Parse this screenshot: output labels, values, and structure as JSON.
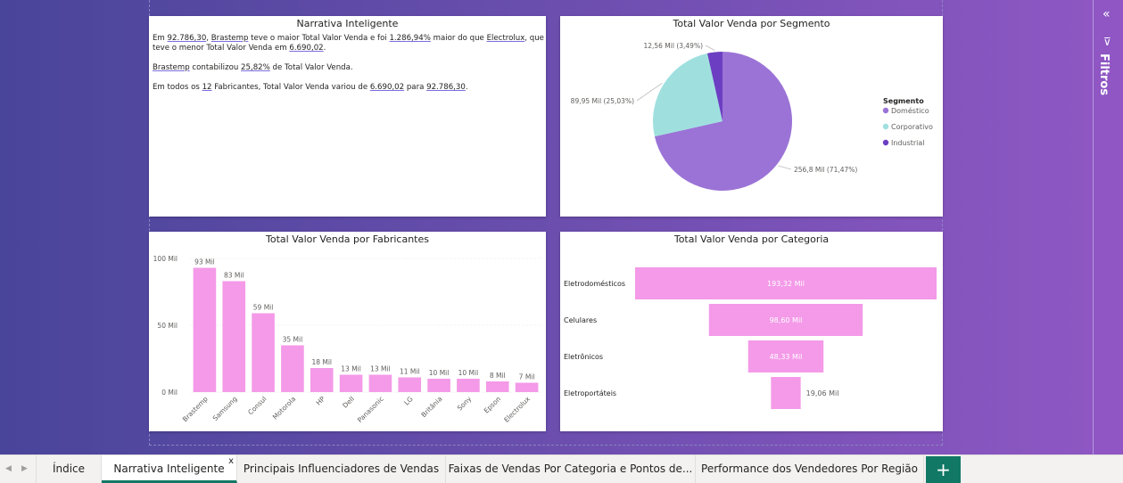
{
  "narrative": {
    "title": "Narrativa Inteligente",
    "paragraphs": [
      [
        {
          "t": "Em "
        },
        {
          "t": "92.786,30",
          "u": true
        },
        {
          "t": ", "
        },
        {
          "t": "Brastemp",
          "u": true
        },
        {
          "t": " teve o maior Total Valor Venda e foi "
        },
        {
          "t": "1.286,94%",
          "u": true
        },
        {
          "t": " maior do que "
        },
        {
          "t": "Electrolux",
          "u": true
        },
        {
          "t": ", que teve o menor Total Valor Venda em "
        },
        {
          "t": "6.690,02",
          "u": true
        },
        {
          "t": "."
        }
      ],
      [
        {
          "t": "Brastemp",
          "u": true
        },
        {
          "t": " contabilizou "
        },
        {
          "t": "25,82%",
          "u": true
        },
        {
          "t": " de Total Valor Venda."
        }
      ],
      [
        {
          "t": "Em todos os "
        },
        {
          "t": "12",
          "u": true
        },
        {
          "t": " Fabricantes, Total Valor Venda variou de "
        },
        {
          "t": "6.690,02",
          "u": true
        },
        {
          "t": " para "
        },
        {
          "t": "92.786,30",
          "u": true
        },
        {
          "t": "."
        }
      ]
    ]
  },
  "chart_data": [
    {
      "type": "pie",
      "title": "Total Valor Venda por Segmento",
      "legend_title": "Segmento",
      "legend_position": "right",
      "slices": [
        {
          "name": "Doméstico",
          "value": 256.8,
          "label": "256,8 Mil (71,47%)",
          "color": "#9b73d6"
        },
        {
          "name": "Corporativo",
          "value": 89.95,
          "label": "89,95 Mil (25,03%)",
          "color": "#9fe0df"
        },
        {
          "name": "Industrial",
          "value": 12.56,
          "label": "12,56 Mil (3,49%)",
          "color": "#6c3fc2"
        }
      ]
    },
    {
      "type": "bar",
      "title": "Total Valor Venda por Fabricantes",
      "categories": [
        "Brastemp",
        "Samsung",
        "Consul",
        "Motorola",
        "HP",
        "Dell",
        "Panasonic",
        "LG",
        "Britânia",
        "Sony",
        "Epson",
        "Electrolux"
      ],
      "values": [
        93,
        83,
        59,
        35,
        18,
        13,
        13,
        11,
        10,
        10,
        8,
        7
      ],
      "value_labels": [
        "93 Mil",
        "83 Mil",
        "59 Mil",
        "35 Mil",
        "18 Mil",
        "13 Mil",
        "13 Mil",
        "11 Mil",
        "10 Mil",
        "10 Mil",
        "8 Mil",
        "7 Mil"
      ],
      "yticks": [
        "100 Mil",
        "50 Mil",
        "0 Mil"
      ],
      "ylim": [
        0,
        100
      ],
      "color": "#f49ae8",
      "grid": true
    },
    {
      "type": "bar",
      "orientation": "funnel",
      "title": "Total Valor Venda por Categoria",
      "categories": [
        "Eletrodomésticos",
        "Celulares",
        "Eletrônicos",
        "Eletroportáteis"
      ],
      "values": [
        193.32,
        98.6,
        48.33,
        19.06
      ],
      "value_labels": [
        "193,32 Mil",
        "98,60 Mil",
        "48,33 Mil",
        "19,06 Mil"
      ],
      "color": "#f49ae8"
    }
  ],
  "filters": {
    "label": "Filtros",
    "collapse_icon": "double-chevron-left",
    "filter_icon": "funnel"
  },
  "tabs": {
    "items": [
      "Índice",
      "Narrativa Inteligente",
      "Principais Influenciadores de Vendas",
      "Faixas de Vendas Por Categoria e Pontos de...",
      "Performance dos Vendedores Por Região"
    ],
    "active": "Narrativa Inteligente",
    "close_label": "x",
    "add_label": "+",
    "accent": "#117865"
  }
}
